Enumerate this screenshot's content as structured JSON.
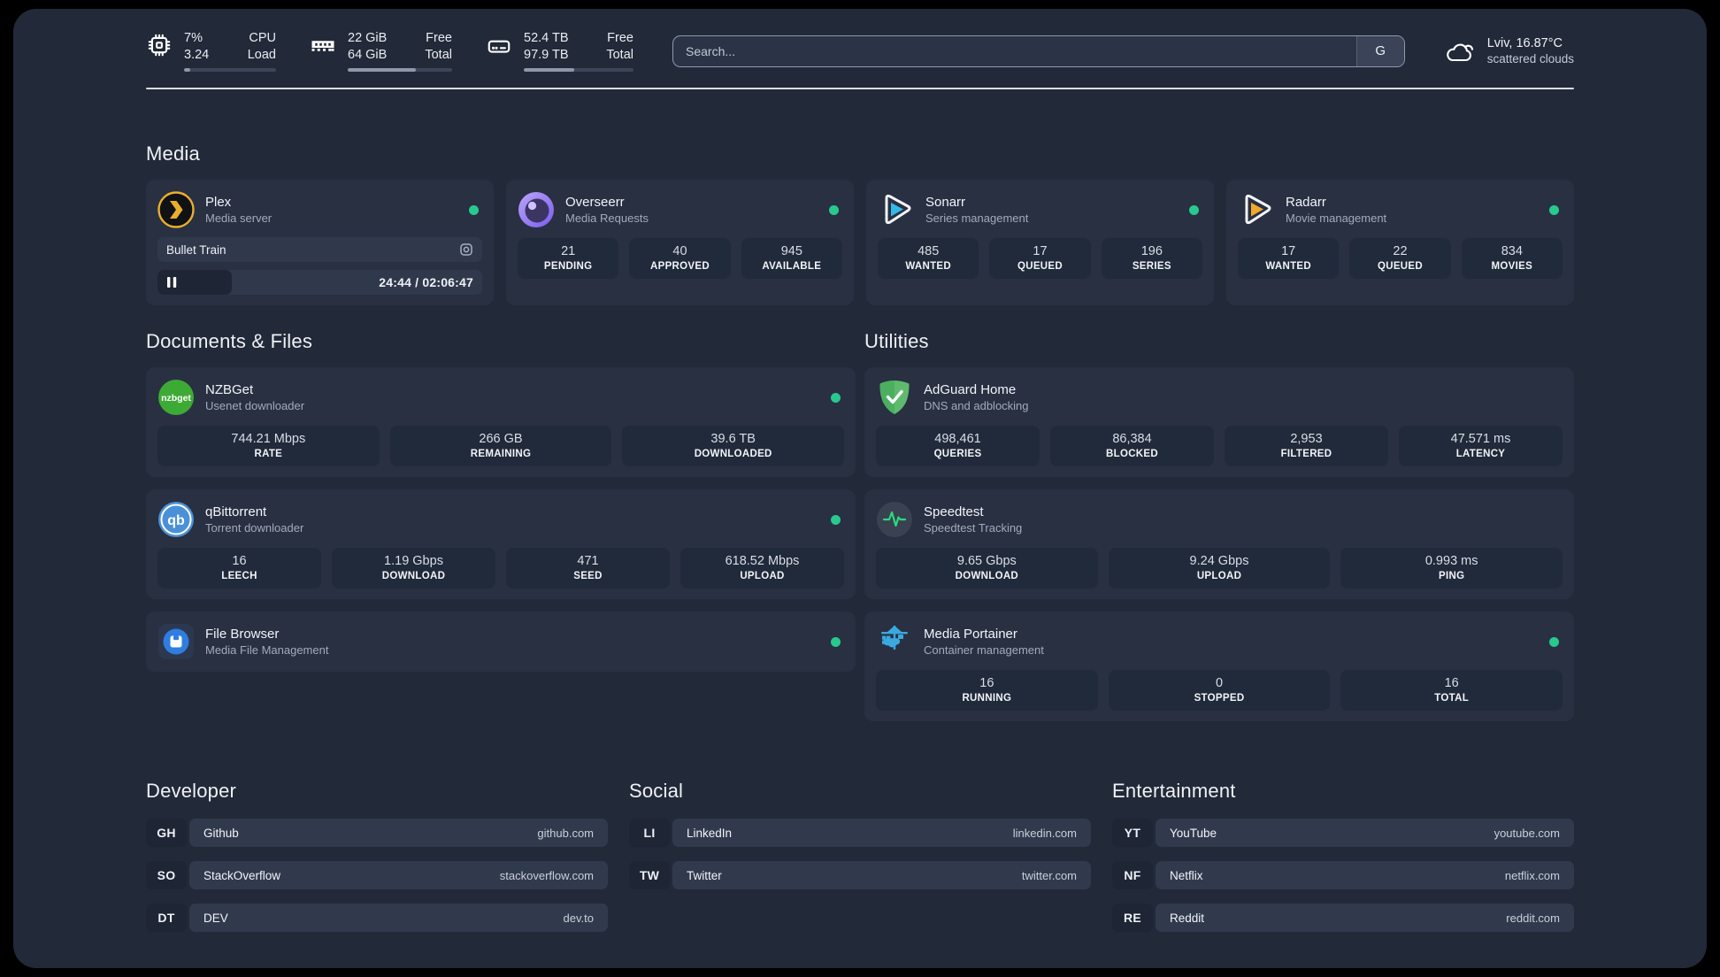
{
  "topbar": {
    "metrics": [
      {
        "id": "cpu",
        "col1": [
          "7%",
          "3.24"
        ],
        "col2": [
          "CPU",
          "Load"
        ],
        "progress_pct": 7
      },
      {
        "id": "memory",
        "col1": [
          "22 GiB",
          "64 GiB"
        ],
        "col2": [
          "Free",
          "Total"
        ],
        "progress_pct": 65
      },
      {
        "id": "disk",
        "col1": [
          "52.4 TB",
          "97.9 TB"
        ],
        "col2": [
          "Free",
          "Total"
        ],
        "progress_pct": 46
      }
    ],
    "search": {
      "placeholder": "Search...",
      "provider_button": "G"
    },
    "weather": {
      "location": "Lviv, 16.87°C",
      "condition": "scattered clouds"
    }
  },
  "sections": {
    "media": {
      "title": "Media",
      "cards": [
        {
          "title": "Plex",
          "subtitle": "Media server",
          "status": "online",
          "now_playing": {
            "title": "Bullet Train",
            "time": "24:44 / 02:06:47",
            "state": "paused",
            "progress_pct": 23
          }
        },
        {
          "title": "Overseerr",
          "subtitle": "Media Requests",
          "status": "online",
          "stats": [
            {
              "value": "21",
              "label": "PENDING"
            },
            {
              "value": "40",
              "label": "APPROVED"
            },
            {
              "value": "945",
              "label": "AVAILABLE"
            }
          ]
        },
        {
          "title": "Sonarr",
          "subtitle": "Series management",
          "status": "online",
          "stats": [
            {
              "value": "485",
              "label": "WANTED"
            },
            {
              "value": "17",
              "label": "QUEUED"
            },
            {
              "value": "196",
              "label": "SERIES"
            }
          ]
        },
        {
          "title": "Radarr",
          "subtitle": "Movie management",
          "status": "online",
          "stats": [
            {
              "value": "17",
              "label": "WANTED"
            },
            {
              "value": "22",
              "label": "QUEUED"
            },
            {
              "value": "834",
              "label": "MOVIES"
            }
          ]
        }
      ]
    },
    "documents": {
      "title": "Documents & Files",
      "cards": [
        {
          "title": "NZBGet",
          "subtitle": "Usenet downloader",
          "status": "online",
          "stats": [
            {
              "value": "744.21 Mbps",
              "label": "RATE"
            },
            {
              "value": "266 GB",
              "label": "REMAINING"
            },
            {
              "value": "39.6 TB",
              "label": "DOWNLOADED"
            }
          ]
        },
        {
          "title": "qBittorrent",
          "subtitle": "Torrent downloader",
          "status": "online",
          "stats": [
            {
              "value": "16",
              "label": "LEECH"
            },
            {
              "value": "1.19 Gbps",
              "label": "DOWNLOAD"
            },
            {
              "value": "471",
              "label": "SEED"
            },
            {
              "value": "618.52 Mbps",
              "label": "UPLOAD"
            }
          ]
        },
        {
          "title": "File Browser",
          "subtitle": "Media File Management",
          "status": "online",
          "stats": []
        }
      ]
    },
    "utilities": {
      "title": "Utilities",
      "cards": [
        {
          "title": "AdGuard Home",
          "subtitle": "DNS and adblocking",
          "status": "none",
          "stats": [
            {
              "value": "498,461",
              "label": "QUERIES"
            },
            {
              "value": "86,384",
              "label": "BLOCKED"
            },
            {
              "value": "2,953",
              "label": "FILTERED"
            },
            {
              "value": "47.571 ms",
              "label": "LATENCY"
            }
          ]
        },
        {
          "title": "Speedtest",
          "subtitle": "Speedtest Tracking",
          "status": "none",
          "stats": [
            {
              "value": "9.65 Gbps",
              "label": "DOWNLOAD"
            },
            {
              "value": "9.24 Gbps",
              "label": "UPLOAD"
            },
            {
              "value": "0.993 ms",
              "label": "PING"
            }
          ]
        },
        {
          "title": "Media Portainer",
          "subtitle": "Container management",
          "status": "online",
          "stats": [
            {
              "value": "16",
              "label": "RUNNING"
            },
            {
              "value": "0",
              "label": "STOPPED"
            },
            {
              "value": "16",
              "label": "TOTAL"
            }
          ]
        }
      ]
    },
    "links": [
      {
        "title": "Developer",
        "items": [
          {
            "abbr": "GH",
            "name": "Github",
            "url": "github.com"
          },
          {
            "abbr": "SO",
            "name": "StackOverflow",
            "url": "stackoverflow.com"
          },
          {
            "abbr": "DT",
            "name": "DEV",
            "url": "dev.to"
          }
        ]
      },
      {
        "title": "Social",
        "items": [
          {
            "abbr": "LI",
            "name": "LinkedIn",
            "url": "linkedin.com"
          },
          {
            "abbr": "TW",
            "name": "Twitter",
            "url": "twitter.com"
          }
        ]
      },
      {
        "title": "Entertainment",
        "items": [
          {
            "abbr": "YT",
            "name": "YouTube",
            "url": "youtube.com"
          },
          {
            "abbr": "NF",
            "name": "Netflix",
            "url": "netflix.com"
          },
          {
            "abbr": "RE",
            "name": "Reddit",
            "url": "reddit.com"
          }
        ]
      }
    ]
  },
  "colors": {
    "status_online": "#29c98e",
    "panel_bg": "#222938",
    "card_bg": "#283042",
    "accent_plex": "#ebaf2b",
    "accent_sonarr": "#35b8e8",
    "accent_radarr": "#f0a92c",
    "accent_portainer": "#3ba8e0"
  }
}
